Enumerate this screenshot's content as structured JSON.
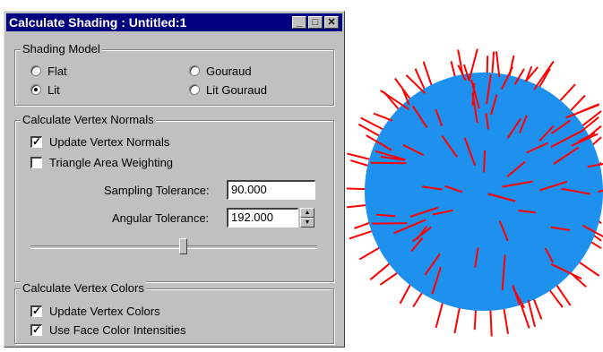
{
  "window": {
    "title": "Calculate Shading : Untitled:1",
    "minimize_glyph": "_",
    "maximize_glyph": "□",
    "close_glyph": "✕"
  },
  "shading_model": {
    "legend": "Shading Model",
    "options": [
      {
        "label": "Flat",
        "selected": false
      },
      {
        "label": "Gouraud",
        "selected": false
      },
      {
        "label": "Lit",
        "selected": true
      },
      {
        "label": "Lit Gouraud",
        "selected": false
      }
    ]
  },
  "vertex_normals": {
    "legend": "Calculate Vertex Normals",
    "update_label": "Update Vertex Normals",
    "update_checked": true,
    "triangle_label": "Triangle Area Weighting",
    "triangle_checked": false,
    "sampling_label": "Sampling Tolerance:",
    "sampling_value": "90.000",
    "angular_label": "Angular Tolerance:",
    "angular_value": "192.000",
    "slider_fraction": 0.53
  },
  "vertex_colors": {
    "legend": "Calculate Vertex Colors",
    "update_label": "Update Vertex Colors",
    "update_checked": true,
    "face_label": "Use Face Color Intensities",
    "face_checked": true
  },
  "colors": {
    "title_bar": "#000080",
    "dialog_bg": "#c0c0c0",
    "sphere": "#1e90ee",
    "normals": "#ff0000"
  },
  "icons": {
    "check": "✓",
    "spin_up": "▲",
    "spin_down": "▼"
  }
}
